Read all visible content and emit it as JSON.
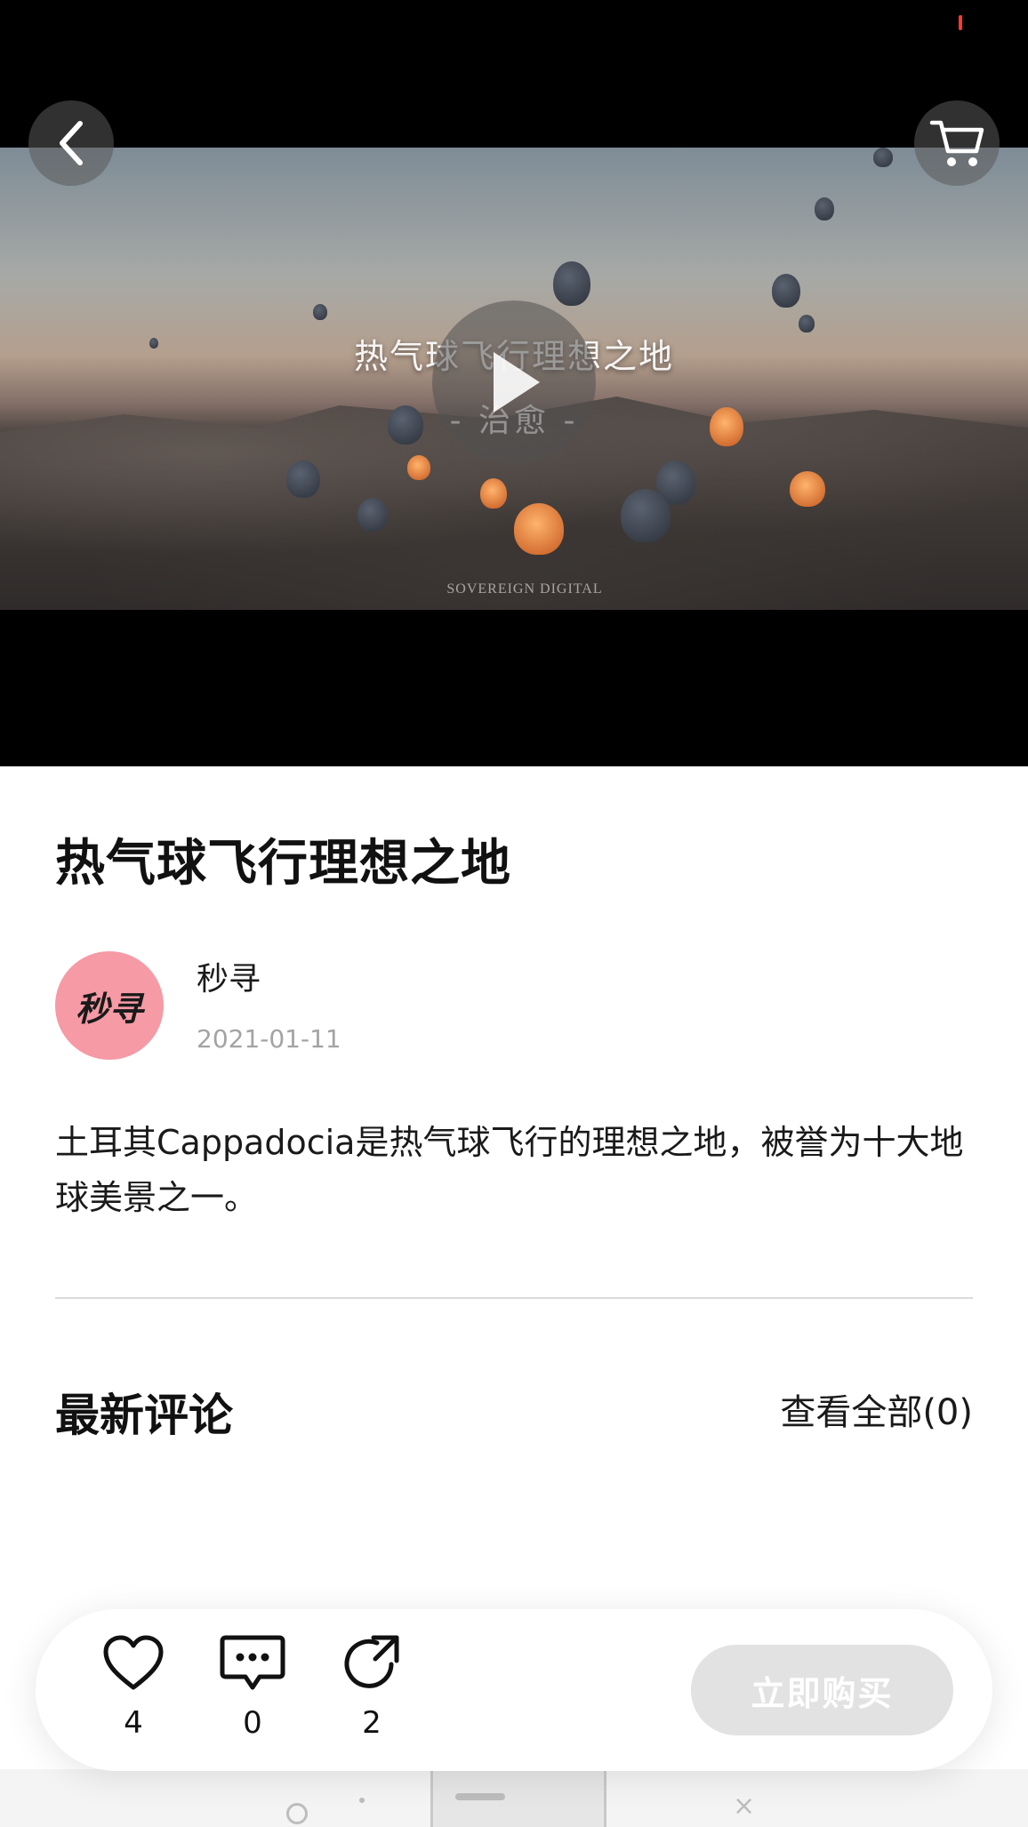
{
  "video": {
    "overlay_title": "热气球飞行理想之地",
    "overlay_subtitle": "- 治愈 -",
    "watermark": "SOVEREIGN DIGITAL"
  },
  "post": {
    "title": "热气球飞行理想之地",
    "author": {
      "avatar_text": "秒寻",
      "name": "秒寻",
      "date": "2021-01-11"
    },
    "description": "土耳其Cappadocia是热气球飞行的理想之地，被誉为十大地球美景之一。"
  },
  "comments": {
    "title": "最新评论",
    "view_all": "查看全部(0)"
  },
  "actions": {
    "like_count": "4",
    "comment_count": "0",
    "share_count": "2",
    "buy_label": "立即购买"
  },
  "colors": {
    "avatar_bg": "#f69aa5",
    "buy_button_disabled": "#e2e2e2",
    "status_indicator": "#ff3b30"
  },
  "icons": {
    "back": "chevron-left-icon",
    "cart": "cart-icon",
    "play": "play-icon",
    "like": "heart-icon",
    "comment": "comment-bubble-icon",
    "share": "share-arrow-icon"
  }
}
